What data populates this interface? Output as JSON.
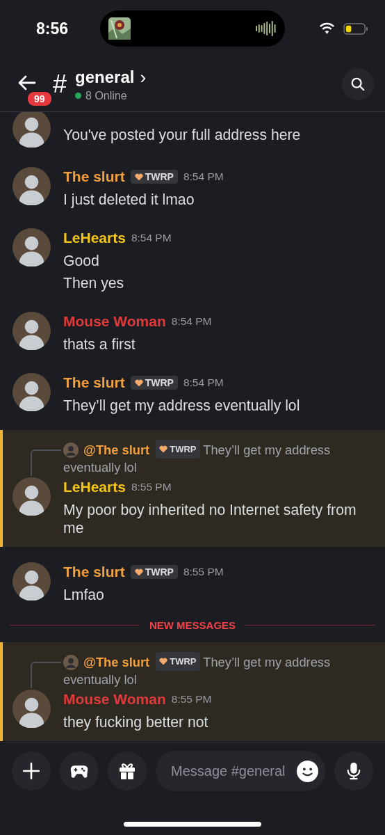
{
  "status_bar": {
    "time": "8:56"
  },
  "header": {
    "unread_badge": "99",
    "channel_symbol": "#",
    "channel": "general",
    "chevron": "›",
    "online": "8 Online"
  },
  "messages": [
    {
      "kind": "message",
      "highlighted": false,
      "lines": [
        "You've posted your full address here"
      ]
    },
    {
      "kind": "message",
      "author": "The slurt",
      "color": "#f0a040",
      "badge": "TWRP",
      "time": "8:54 PM",
      "highlighted": false,
      "lines": [
        "I just deleted it lmao"
      ]
    },
    {
      "kind": "message",
      "author": "LeHearts",
      "color": "#f5c518",
      "time": "8:54 PM",
      "highlighted": false,
      "lines": [
        "Good",
        "Then yes"
      ]
    },
    {
      "kind": "message",
      "author": "Mouse Woman",
      "color": "#e03a3a",
      "time": "8:54 PM",
      "highlighted": false,
      "lines": [
        "thats a first"
      ]
    },
    {
      "kind": "message",
      "author": "The slurt",
      "color": "#f0a040",
      "badge": "TWRP",
      "time": "8:54 PM",
      "highlighted": false,
      "lines": [
        "They’ll get my address eventually lol"
      ]
    },
    {
      "kind": "message",
      "author": "LeHearts",
      "color": "#f5c518",
      "time": "8:55 PM",
      "highlighted": true,
      "reply": {
        "author": "@The slurt",
        "color": "#f0a040",
        "badge": "TWRP",
        "text": "They’ll get my address eventually lol"
      },
      "lines": [
        "My poor boy inherited no Internet safety from me"
      ]
    },
    {
      "kind": "message",
      "author": "The slurt",
      "color": "#f0a040",
      "badge": "TWRP",
      "time": "8:55 PM",
      "highlighted": false,
      "lines": [
        "Lmfao"
      ]
    },
    {
      "kind": "divider",
      "label": "NEW MESSAGES"
    },
    {
      "kind": "message",
      "author": "Mouse Woman",
      "color": "#e03a3a",
      "time": "8:55 PM",
      "highlighted": true,
      "reply": {
        "author": "@The slurt",
        "color": "#f0a040",
        "badge": "TWRP",
        "text": "They’ll get my address eventually lol"
      },
      "lines": [
        "they fucking better not"
      ]
    }
  ],
  "composer": {
    "placeholder": "Message #general"
  }
}
